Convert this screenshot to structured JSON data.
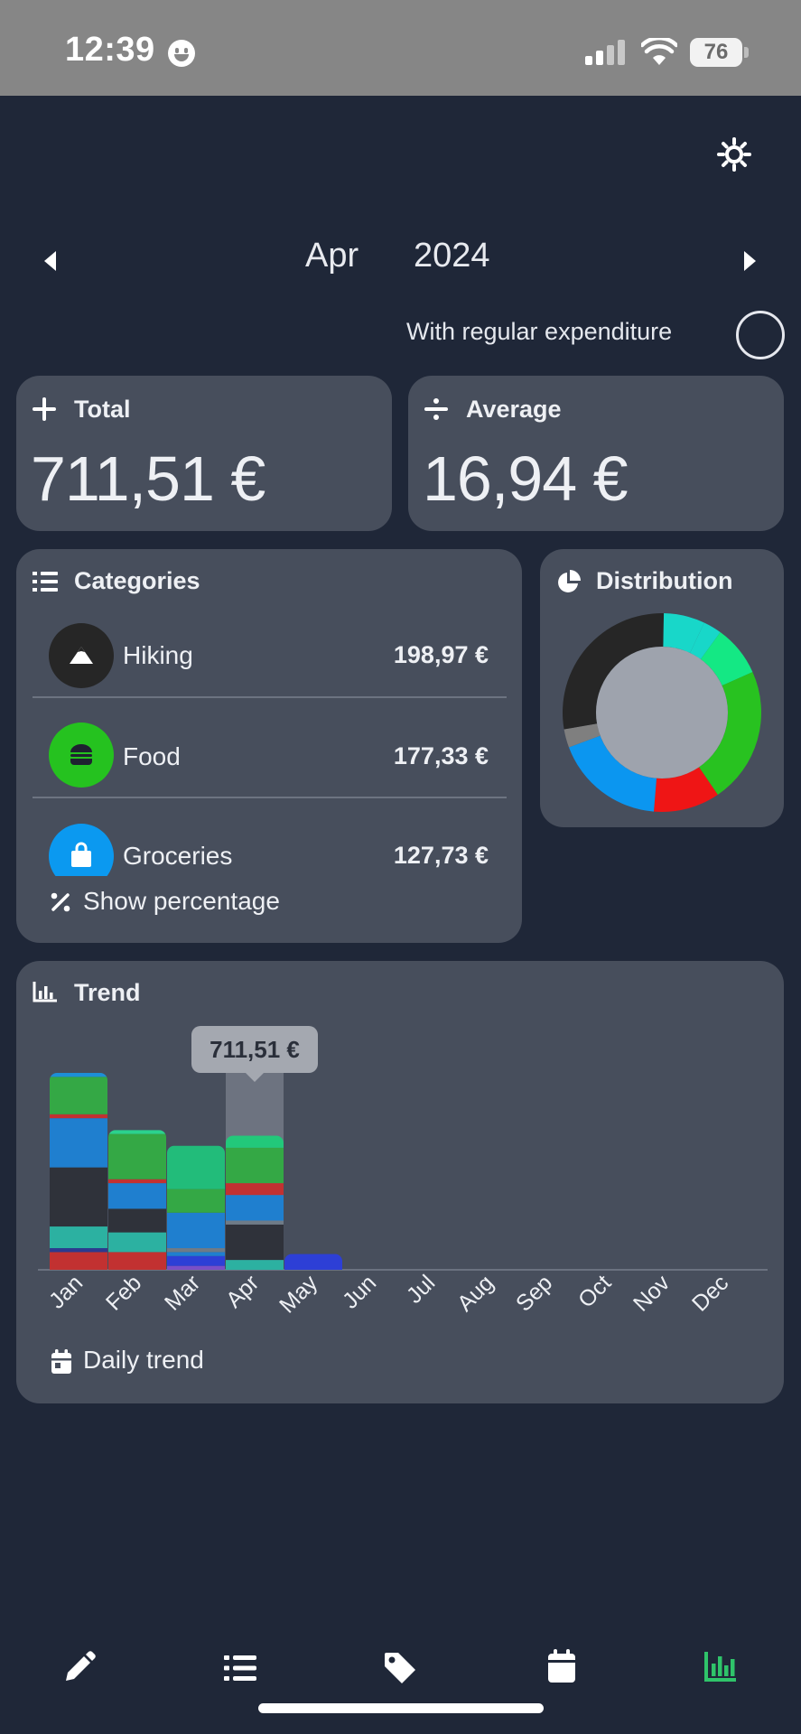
{
  "status": {
    "time": "12:39",
    "battery": "76"
  },
  "period": {
    "month": "Apr",
    "year": "2024"
  },
  "regular": {
    "label": "With regular expenditure"
  },
  "total": {
    "title": "Total",
    "value": "711,51 €"
  },
  "average": {
    "title": "Average",
    "value": "16,94 €"
  },
  "categories": {
    "title": "Categories",
    "items": [
      {
        "name": "Hiking",
        "amount": "198,97 €",
        "color": "#262626",
        "icon": "mountain-icon"
      },
      {
        "name": "Food",
        "amount": "177,33 €",
        "color": "#25c21f",
        "icon": "burger-icon"
      },
      {
        "name": "Groceries",
        "amount": "127,73 €",
        "color": "#0b99f0",
        "icon": "shopping-bag-icon"
      }
    ],
    "show_percentage": "Show percentage"
  },
  "distribution": {
    "title": "Distribution",
    "slices": [
      {
        "share": 0.03,
        "color": "#18d7c9"
      },
      {
        "share": 0.083,
        "color": "#14e884"
      },
      {
        "share": 0.222,
        "color": "#28c220"
      },
      {
        "share": 0.108,
        "color": "#ef1515"
      },
      {
        "share": 0.18,
        "color": "#0b96f0"
      },
      {
        "share": 0.03,
        "color": "#7f7f7f"
      },
      {
        "share": 0.28,
        "color": "#262626"
      },
      {
        "share": 0.067,
        "color": "#18d7c9"
      }
    ]
  },
  "trend": {
    "title": "Trend",
    "tooltip": "711,51 €",
    "daily_trend": "Daily trend"
  },
  "chart_data": {
    "type": "bar",
    "stacked": true,
    "categories": [
      "Jan",
      "Feb",
      "Mar",
      "Apr",
      "May",
      "Jun",
      "Jul",
      "Aug",
      "Sep",
      "Oct",
      "Nov",
      "Dec"
    ],
    "selected": "Apr",
    "selected_total": 711.51,
    "totals_relative": [
      1.0,
      0.71,
      0.63,
      0.681,
      0.08,
      0,
      0,
      0,
      0,
      0,
      0,
      0
    ],
    "segments": [
      [
        [
          "#c23131",
          0.09
        ],
        [
          "#2d3a8f",
          0.02
        ],
        [
          "#2cb1a1",
          0.11
        ],
        [
          "#2f323a",
          0.3
        ],
        [
          "#1f7fcf",
          0.25
        ],
        [
          "#c23131",
          0.02
        ],
        [
          "#34a845",
          0.19
        ],
        [
          "#1d8fd6",
          0.02
        ]
      ],
      [
        [
          "#c23131",
          0.09
        ],
        [
          "#2cb1a1",
          0.1
        ],
        [
          "#2f323a",
          0.12
        ],
        [
          "#1f7fcf",
          0.13
        ],
        [
          "#c23131",
          0.02
        ],
        [
          "#34a845",
          0.23
        ],
        [
          "#2bd28d",
          0.02
        ]
      ],
      [
        [
          "#7a4fc7",
          0.02
        ],
        [
          "#2d3fd6",
          0.05
        ],
        [
          "#1f7fcf",
          0.02
        ],
        [
          "#6f7b87",
          0.02
        ],
        [
          "#1f7fcf",
          0.18
        ],
        [
          "#34a845",
          0.12
        ],
        [
          "#22bc7a",
          0.22
        ]
      ],
      [
        [
          "#2cb1a1",
          0.05
        ],
        [
          "#2f323a",
          0.18
        ],
        [
          "#6f7b87",
          0.02
        ],
        [
          "#1f7fcf",
          0.13
        ],
        [
          "#c23131",
          0.06
        ],
        [
          "#34a845",
          0.18
        ],
        [
          "#22c87a",
          0.061
        ]
      ],
      [
        [
          "#2d3fd6",
          0.08
        ]
      ]
    ]
  },
  "tabs": [
    {
      "icon": "pencil-icon",
      "active": false
    },
    {
      "icon": "list-icon",
      "active": false
    },
    {
      "icon": "tag-icon",
      "active": false
    },
    {
      "icon": "calendar-icon",
      "active": false
    },
    {
      "icon": "chart-icon",
      "active": true
    }
  ]
}
